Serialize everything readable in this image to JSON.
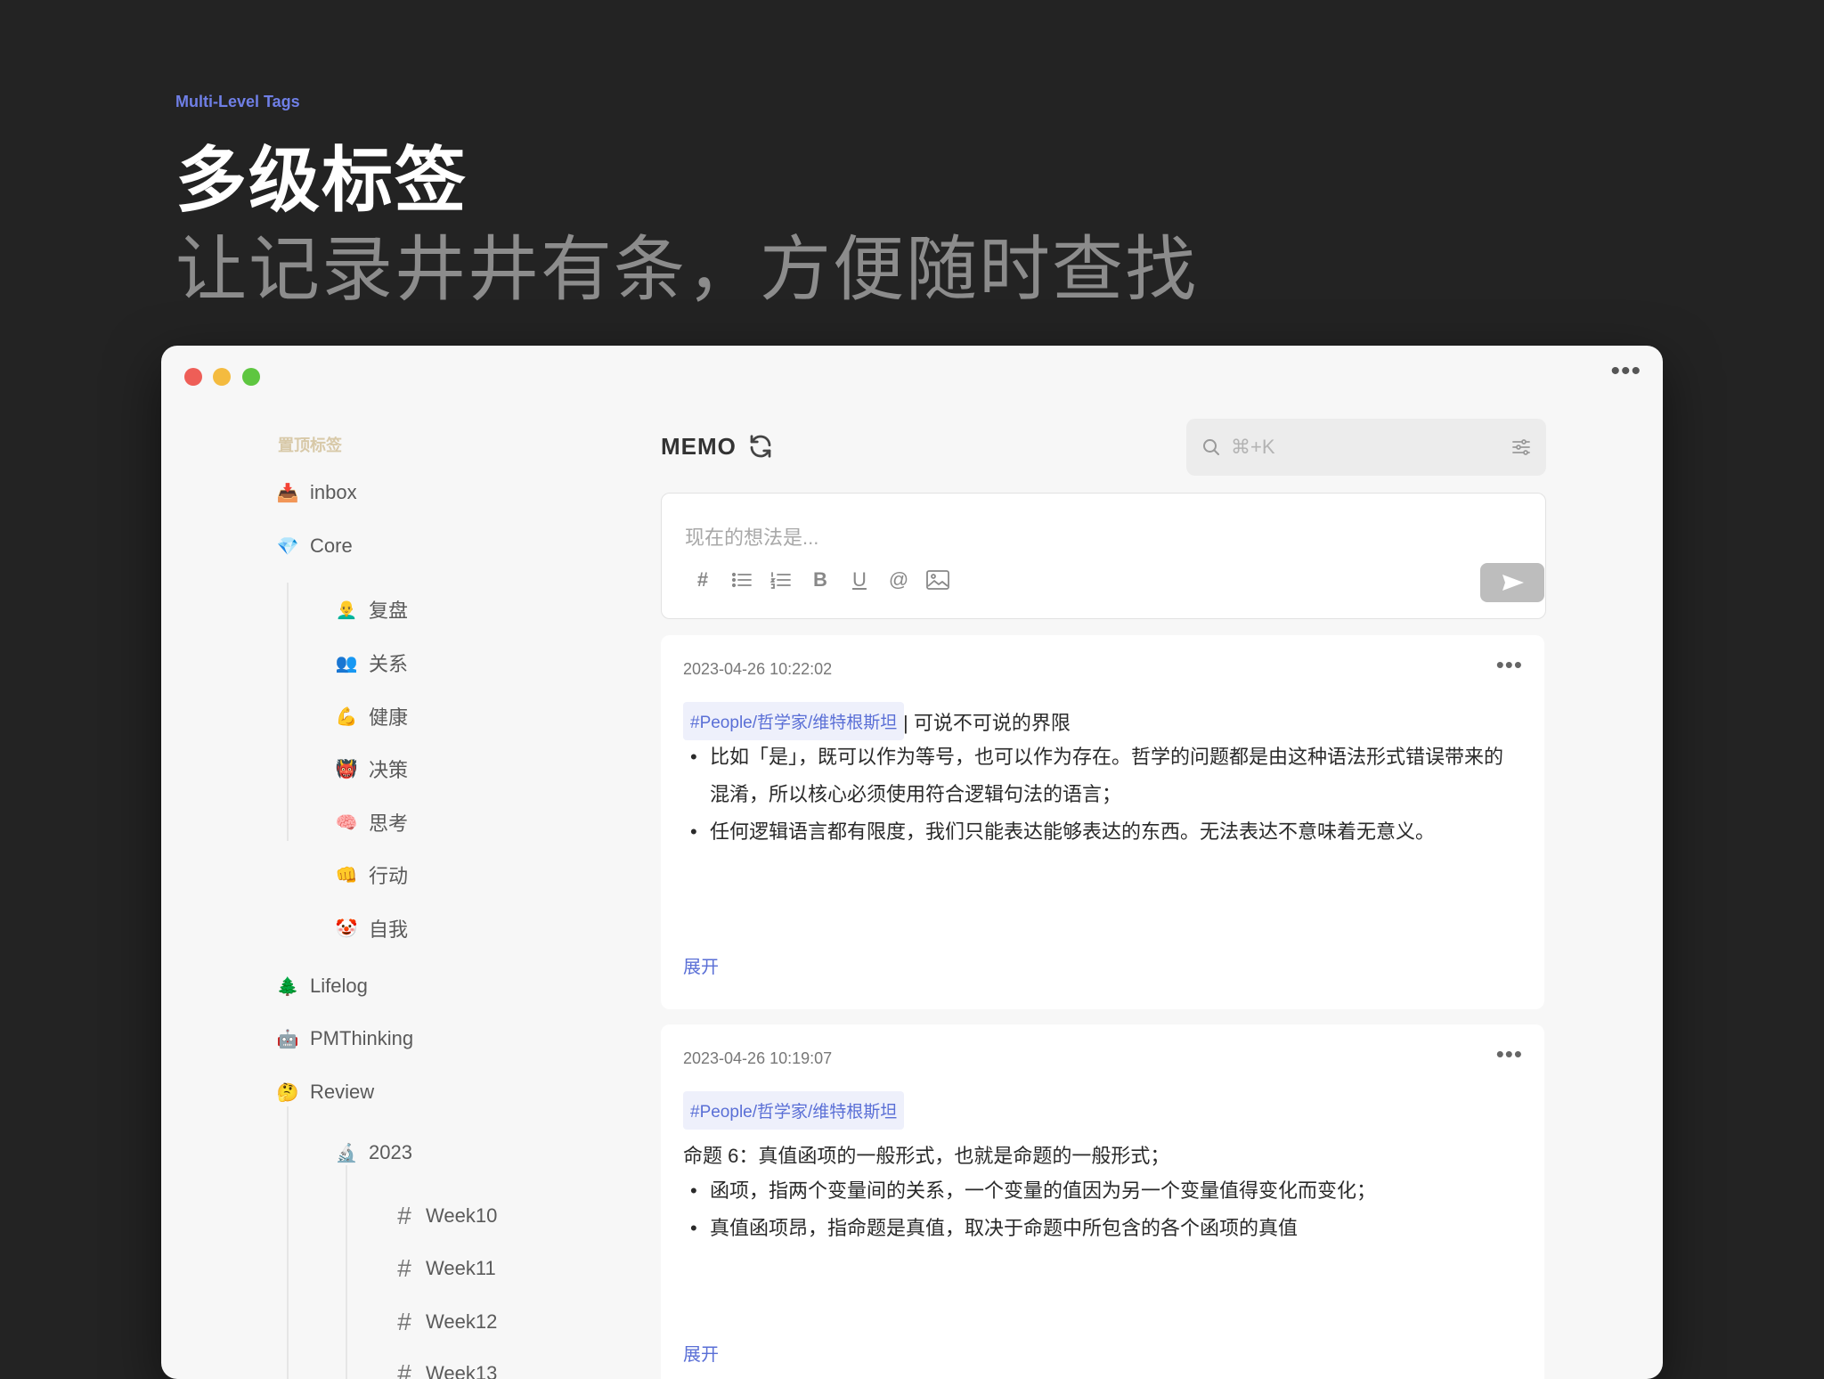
{
  "hero": {
    "eyebrow": "Multi-Level Tags",
    "title": "多级标签",
    "subtitle": "让记录井井有条，方便随时查找"
  },
  "window": {
    "more": "•••"
  },
  "sidebar": {
    "pinned_label": "置顶标签",
    "tags": [
      {
        "icon": "📥",
        "label": "inbox"
      },
      {
        "icon": "💎",
        "label": "Core"
      },
      {
        "icon": "👨‍🦲",
        "label": "复盘"
      },
      {
        "icon": "👥",
        "label": "关系"
      },
      {
        "icon": "💪",
        "label": "健康"
      },
      {
        "icon": "👹",
        "label": "决策"
      },
      {
        "icon": "🧠",
        "label": "思考"
      },
      {
        "icon": "👊",
        "label": "行动"
      },
      {
        "icon": "🤡",
        "label": "自我"
      },
      {
        "icon": "🌲",
        "label": "Lifelog"
      },
      {
        "icon": "🤖",
        "label": "PMThinking"
      },
      {
        "icon": "🤔",
        "label": "Review"
      },
      {
        "icon": "🔬",
        "label": "2023"
      },
      {
        "icon": "#",
        "label": "Week10"
      },
      {
        "icon": "#",
        "label": "Week11"
      },
      {
        "icon": "#",
        "label": "Week12"
      },
      {
        "icon": "#",
        "label": "Week13"
      }
    ]
  },
  "main": {
    "title": "MEMO",
    "search_placeholder": "⌘+K",
    "editor_placeholder": "现在的想法是...",
    "toolbar": [
      "#",
      "B",
      "U",
      "@"
    ],
    "cards": [
      {
        "timestamp": "2023-04-26 10:22:02",
        "more": "•••",
        "tag": "#People/哲学家/维特根斯坦",
        "heading": "| 可说不可说的界限",
        "bullets": [
          "比如「是」，既可以作为等号，也可以作为存在。哲学的问题都是由这种语法形式错误带来的混淆，所以核心必须使用符合逻辑句法的语言；",
          "任何逻辑语言都有限度，我们只能表达能够表达的东西。无法表达不意味着无意义。"
        ],
        "expand": "展开"
      },
      {
        "timestamp": "2023-04-26 10:19:07",
        "more": "•••",
        "tag": "#People/哲学家/维特根斯坦",
        "heading": "命题 6：真值函项的一般形式，也就是命题的一般形式；",
        "bullets": [
          "函项，指两个变量间的关系，一个变量的值因为另一个变量值得变化而变化；",
          "真值函项昂，指命题是真值，取决于命题中所包含的各个函项的真值"
        ],
        "expand": "展开"
      }
    ]
  }
}
